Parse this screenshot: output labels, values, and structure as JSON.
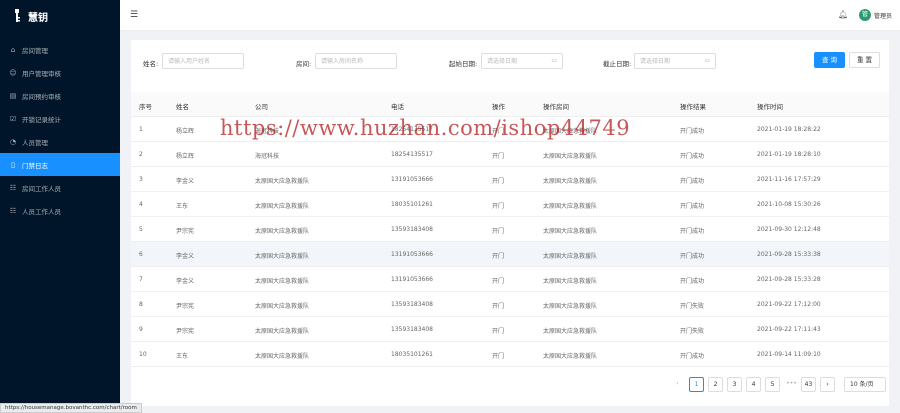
{
  "app": {
    "logo_text": "慧钥",
    "logo_icon": "key-icon"
  },
  "sidebar": {
    "items": [
      {
        "label": "房间管理",
        "icon": "home-icon",
        "active": false
      },
      {
        "label": "用户管理审核",
        "icon": "user-icon",
        "active": false
      },
      {
        "label": "房间预约审核",
        "icon": "calendar-icon",
        "active": false
      },
      {
        "label": "开锁记录统计",
        "icon": "chart-icon",
        "active": false
      },
      {
        "label": "人员管理",
        "icon": "person-icon",
        "active": false
      },
      {
        "label": "门禁日志",
        "icon": "door-icon",
        "active": true
      },
      {
        "label": "房间工作人员",
        "icon": "team-icon",
        "active": false
      },
      {
        "label": "人员工作人员",
        "icon": "team-icon",
        "active": false
      }
    ]
  },
  "header": {
    "user_name": "管理员",
    "avatar_text": "管"
  },
  "filter": {
    "name_label": "姓名:",
    "name_placeholder": "请输入用户姓名",
    "room_label": "房间:",
    "room_placeholder": "请输入房间名称",
    "start_label": "起始日期:",
    "start_placeholder": "请选择日期",
    "end_label": "截止日期:",
    "end_placeholder": "请选择日期",
    "query_label": "查 询",
    "reset_label": "重 置"
  },
  "table": {
    "columns": [
      "序号",
      "姓名",
      "公司",
      "电话",
      "操作",
      "操作房间",
      "操作结果",
      "操作时间"
    ],
    "rows": [
      [
        "1",
        "杨立辉",
        "海冠科技",
        "18254135517",
        "开门",
        "太原国大应急救援队",
        "开门成功",
        "2021-01-19 18:28:22"
      ],
      [
        "2",
        "杨立辉",
        "海冠科技",
        "18254135517",
        "开门",
        "太原国大应急救援队",
        "开门成功",
        "2021-01-19 18:28:10"
      ],
      [
        "3",
        "李金义",
        "太原国大应急救援队",
        "13191053666",
        "开门",
        "太原国大应急救援队",
        "开门成功",
        "2021-11-16 17:57:29"
      ],
      [
        "4",
        "王东",
        "太原国大应急救援队",
        "18035101261",
        "开门",
        "太原国大应急救援队",
        "开门成功",
        "2021-10-08 15:30:26"
      ],
      [
        "5",
        "尹宗宪",
        "太原国大应急救援队",
        "13593183408",
        "开门",
        "太原国大应急救援队",
        "开门成功",
        "2021-09-30 12:12:48"
      ],
      [
        "6",
        "李金义",
        "太原国大应急救援队",
        "13191053666",
        "开门",
        "太原国大应急救援队",
        "开门成功",
        "2021-09-28 15:33:38"
      ],
      [
        "7",
        "李金义",
        "太原国大应急救援队",
        "13191053666",
        "开门",
        "太原国大应急救援队",
        "开门成功",
        "2021-09-28 15:33:28"
      ],
      [
        "8",
        "尹宗宪",
        "太原国大应急救援队",
        "13593183408",
        "开门",
        "太原国大应急救援队",
        "开门失败",
        "2021-09-22 17:12:00"
      ],
      [
        "9",
        "尹宗宪",
        "太原国大应急救援队",
        "13593183408",
        "开门",
        "太原国大应急救援队",
        "开门失败",
        "2021-09-22 17:11:43"
      ],
      [
        "10",
        "王东",
        "太原国大应急救援队",
        "18035101261",
        "开门",
        "太原国大应急救援队",
        "开门成功",
        "2021-09-14 11:09:10"
      ]
    ]
  },
  "watermark": "https://www.huzhan.com/ishop44749",
  "pagination": {
    "prev": "‹",
    "pages": [
      "1",
      "2",
      "3",
      "4",
      "5"
    ],
    "ellipsis": "•••",
    "last": "43",
    "next": "›",
    "page_size": "10 条/页",
    "current": "1"
  },
  "status_url": "https://housemanage.bovanthc.com/chart/room"
}
